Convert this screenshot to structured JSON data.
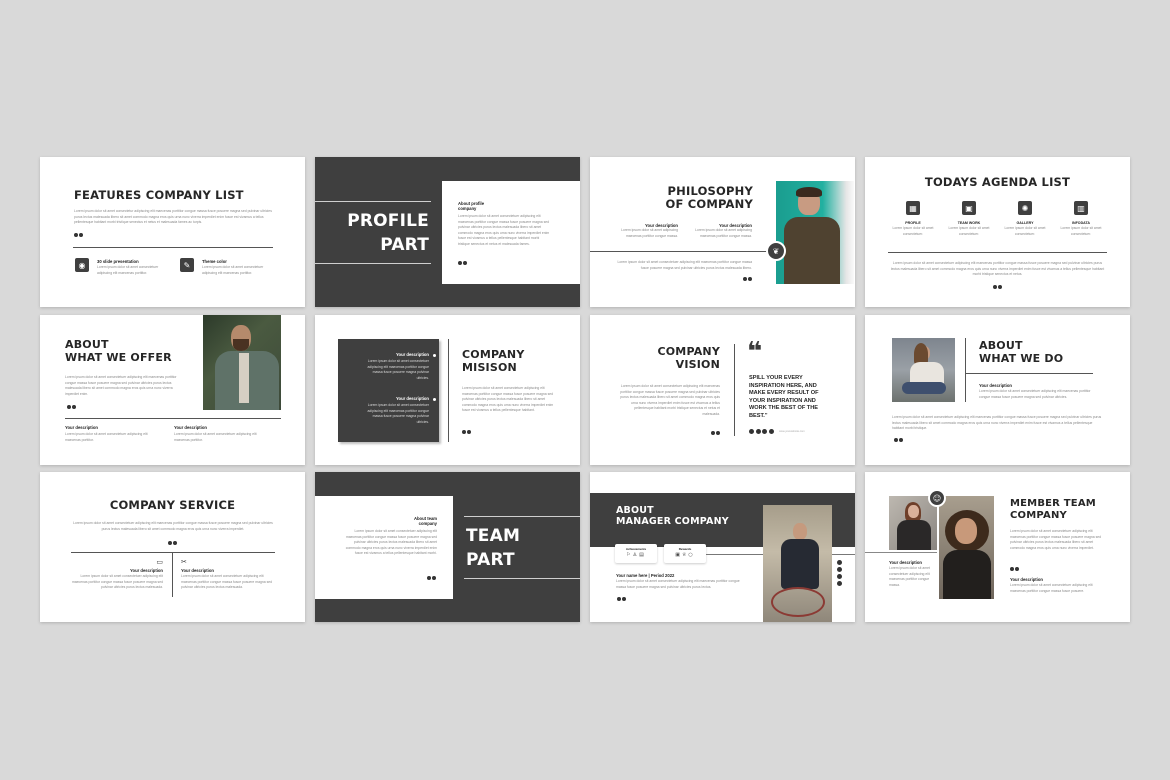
{
  "slides": [
    {
      "title": "FEATURES COMPANY LIST",
      "body": "Lorem ipsum dolor sit amet consectetur adipiscing elit maecenas porttitor congue massa fusce posuere magna sed pulvinar ultricies purus lectus malesuada libero sit amet commodo magna eros quis urna nunc viverra imperdiet enim fusce est vivamus a tellus pellentesque habitant morbi tristique senectus et netus et malesuada fames ac turpis.",
      "features": [
        {
          "icon": "presentation-icon",
          "glyph": "◉",
          "label": "30 slide presentation",
          "text": "Lorem ipsum dolor sit amet consectetuer adipiscing elit maecenas porttitor."
        },
        {
          "icon": "palette-icon",
          "glyph": "✎",
          "label": "Theme color",
          "text": "Lorem ipsum dolor sit amet consectetuer adipiscing elit maecenas porttitor."
        }
      ]
    },
    {
      "title_line1": "PROFILE",
      "title_line2": "PART",
      "card_title": "About profile company",
      "card_body": "Lorem ipsum dolor sit amet consectetuer adipiscing elit maecenas porttitor congue massa fusce posuere magna sed pulvinar ultricies purus lectus malesuada libero sit amet commodo magna eros quis urna nunc viverra imperdiet enim fusce est vivamus a tellus pellentesque habitant morbi tristique senectus et netus et malesuada fames."
    },
    {
      "title_line1": "PHILOSOPHY",
      "title_line2": "OF COMPANY",
      "cols": [
        {
          "label": "Your description",
          "text": "Lorem ipsum dolor sit amet adipiscing maecenas porttitor congue massa."
        },
        {
          "label": "Your description",
          "text": "Lorem ipsum dolor sit amet adipiscing maecenas porttitor congue massa."
        }
      ],
      "body": "Lorem ipsum dolor sit amet consectetuer adipiscing elit maecenas porttitor congue massa fusce posuere magna sed pulvinar ultricies purus lectus malesuada libero."
    },
    {
      "title": "TODAYS AGENDA LIST",
      "items": [
        {
          "icon": "profile-icon",
          "glyph": "▦",
          "label": "PROFILE",
          "text": "Lorem ipsum dolor sit amet consectetuer."
        },
        {
          "icon": "teamwork-icon",
          "glyph": "▣",
          "label": "TEAM WORK",
          "text": "Lorem ipsum dolor sit amet consectetuer."
        },
        {
          "icon": "gallery-icon",
          "glyph": "✺",
          "label": "GALLERY",
          "text": "Lorem ipsum dolor sit amet consectetuer."
        },
        {
          "icon": "infodata-icon",
          "glyph": "▥",
          "label": "INFODATA",
          "text": "Lorem ipsum dolor sit amet consectetuer."
        }
      ],
      "body": "Lorem ipsum dolor sit amet consectetuer adipiscing elit maecenas porttitor congue massa fusce posuere magna sed pulvinar ultricies purus lectus malesuada libero sit amet commodo magna eros quis urna nunc viverra imperdiet enim fusce est vivamus a tellus pellentesque habitant morbi tristique senectus et netus."
    },
    {
      "title_line1": "ABOUT",
      "title_line2": "WHAT WE OFFER",
      "body": "Lorem ipsum dolor sit amet consectetuer adipiscing elit maecenas porttitor congue massa fusce posuere magna sed pulvinar ultricies purus lectus malesuada libero sit amet commodo magna eros quis urna nunc viverra imperdiet enim.",
      "cols": [
        {
          "label": "Your description",
          "text": "Lorem ipsum dolor sit amet consectetuer adipiscing elit maecenas porttitor."
        },
        {
          "label": "Your description",
          "text": "Lorem ipsum dolor sit amet consectetuer adipiscing elit maecenas porttitor."
        }
      ]
    },
    {
      "title_line1": "COMPANY",
      "title_line2": "MISISON",
      "items": [
        {
          "label": "Your description",
          "text": "Lorem ipsum dolor sit amet consectetuer adipiscing elit maecenas porttitor congue massa fusce posuere magna pulvinar ultricies."
        },
        {
          "label": "Your description",
          "text": "Lorem ipsum dolor sit amet consectetuer adipiscing elit maecenas porttitor congue massa fusce posuere magna pulvinar ultricies."
        }
      ],
      "body": "Lorem ipsum dolor sit amet consectetuer adipiscing elit maecenas porttitor congue massa fusce posuere magna sed pulvinar ultricies purus lectus malesuada libero sit amet commodo magna eros quis urna nunc viverra imperdiet enim fusce est vivamus a tellus pellentesque habitant."
    },
    {
      "title_line1": "COMPANY",
      "title_line2": "VISION",
      "body": "Lorem ipsum dolor sit amet consectetuer adipiscing elit maecenas porttitor congue massa fusce posuere magna sed pulvinar ultricies purus lectus malesuada libero sit amet commodo magna eros quis urna nunc viverra imperdiet enim fusce est vivamus a tellus pellentesque habitant morbi tristique senectus et netus et malesuada.",
      "quote_mark": "❝",
      "quote": "SPILL YOUR EVERY INSPIRATION HERE, AND MAKE EVERY RESULT OF YOUR INSPIRATION AND WORK THE BEST OF THE BEST.\"",
      "social": [
        "instagram-icon",
        "facebook-icon",
        "twitter-icon",
        "linkedin-icon"
      ],
      "social_handle": "www.yourwebsite.com"
    },
    {
      "title_line1": "ABOUT",
      "title_line2": "WHAT WE DO",
      "label": "Your description",
      "text": "Lorem ipsum dolor sit amet consectetuer adipiscing elit maecenas porttitor congue massa fusce posuere magna sed pulvinar ultricies.",
      "body": "Lorem ipsum dolor sit amet consectetuer adipiscing elit maecenas porttitor congue massa fusce posuere magna sed pulvinar ultricies purus lectus malesuada libero sit amet commodo magna eros quis urna nunc viverra imperdiet enim fusce est vivamus a tellus pellentesque habitant morbi tristique."
    },
    {
      "title": "COMPANY SERVICE",
      "body": "Lorem ipsum dolor sit amet consectetuer adipiscing elit maecenas porttitor congue massa fusce posuere magna sed pulvinar ultricies purus lectus malesuada libero sit amet commodo magna eros quis urna nunc viverra imperdiet.",
      "cols": [
        {
          "icon": "monitor-icon",
          "glyph": "▭",
          "label": "Your description",
          "text": "Lorem ipsum dolor sit amet consectetuer adipiscing elit maecenas porttitor congue massa fusce posuere magna sed pulvinar ultricies purus lectus malesuada."
        },
        {
          "icon": "tools-icon",
          "glyph": "✂",
          "label": "Your description",
          "text": "Lorem ipsum dolor sit amet consectetuer adipiscing elit maecenas porttitor congue massa fusce posuere magna sed pulvinar ultricies purus lectus malesuada."
        }
      ]
    },
    {
      "title_line1": "TEAM",
      "title_line2": "PART",
      "card_title": "About team company",
      "card_body": "Lorem ipsum dolor sit amet consectetuer adipiscing elit maecenas porttitor congue massa fusce posuere magna sed pulvinar ultricies purus lectus malesuada libero sit amet commodo magna eros quis urna nunc viverra imperdiet enim fusce est vivamus a tellus pellentesque habitant morbi."
    },
    {
      "title_line1": "ABOUT",
      "title_line2": "MANAGER COMPANY",
      "cards": [
        {
          "label": "Achievements",
          "icons": [
            "bookmark-icon",
            "user-icon",
            "document-icon"
          ],
          "glyphs": [
            "⚐",
            "♙",
            "▤"
          ]
        },
        {
          "label": "Rewards",
          "icons": [
            "calendar-icon",
            "trophy-icon",
            "bulb-icon"
          ],
          "glyphs": [
            "▣",
            "♕",
            "○"
          ]
        }
      ],
      "name": "Your name here | Period 2022",
      "body": "Lorem ipsum dolor sit amet consectetuer adipiscing elit maecenas porttitor congue massa fusce posuere magna sed pulvinar ultricies purus lectus.",
      "social": [
        "instagram-icon",
        "facebook-icon",
        "twitter-icon",
        "linkedin-icon"
      ]
    },
    {
      "title_line1": "MEMBER TEAM",
      "title_line2": "COMPANY",
      "badge_glyph": "☺",
      "left_label": "Your description",
      "left_text": "Lorem ipsum dolor sit amet consectetuer adipiscing elit maecenas porttitor congue massa.",
      "body": "Lorem ipsum dolor sit amet consectetuer adipiscing elit maecenas porttitor congue massa fusce posuere magna sed pulvinar ultricies purus lectus malesuada libero sit amet commodo magna eros quis urna nunc viverra imperdiet.",
      "right_label": "Your description",
      "right_text": "Lorem ipsum dolor sit amet consectetuer adipiscing elit maecenas porttitor congue massa fusce posuere."
    }
  ],
  "colors": {
    "background": "#d9d9d9",
    "slide": "#ffffff",
    "dark": "#3f3f3f",
    "heading": "#262626",
    "teal_photo_bg": "#1fa396"
  }
}
